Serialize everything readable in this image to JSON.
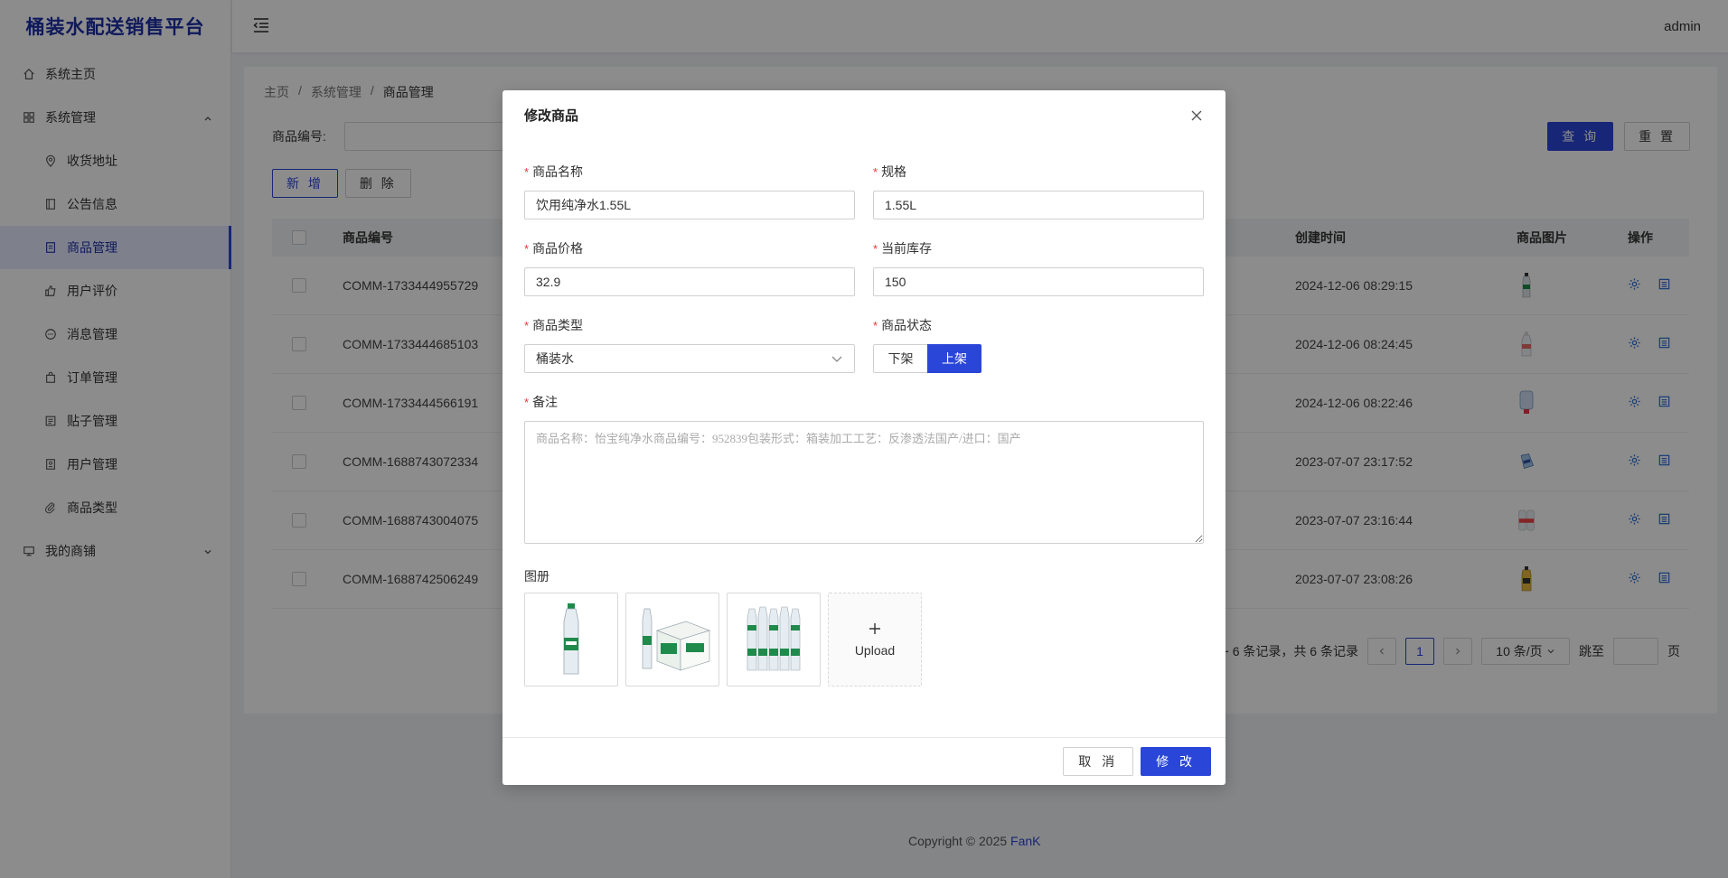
{
  "app": {
    "title": "桶装水配送销售平台",
    "user": "admin"
  },
  "sidebar": {
    "items": [
      {
        "label": "系统主页"
      },
      {
        "label": "系统管理"
      },
      {
        "label": "收货地址"
      },
      {
        "label": "公告信息"
      },
      {
        "label": "商品管理"
      },
      {
        "label": "用户评价"
      },
      {
        "label": "消息管理"
      },
      {
        "label": "订单管理"
      },
      {
        "label": "贴子管理"
      },
      {
        "label": "用户管理"
      },
      {
        "label": "商品类型"
      },
      {
        "label": "我的商铺"
      }
    ]
  },
  "breadcrumb": [
    "主页",
    "/",
    "系统管理",
    "/",
    "商品管理"
  ],
  "search": {
    "label": "商品编号:",
    "query_label": "查 询",
    "reset_label": "重 置"
  },
  "toolbar": {
    "add_label": "新 增",
    "delete_label": "删 除"
  },
  "table": {
    "columns": [
      "商品编号",
      "创建时间",
      "商品图片",
      "操作"
    ],
    "rows": [
      {
        "code": "COMM-1733444955729",
        "time": "2024-12-06 08:29:15"
      },
      {
        "code": "COMM-1733444685103",
        "time": "2024-12-06 08:24:45"
      },
      {
        "code": "COMM-1733444566191",
        "time": "2024-12-06 08:22:46"
      },
      {
        "code": "COMM-1688743072334",
        "time": "2023-07-07 23:17:52"
      },
      {
        "code": "COMM-1688743004075",
        "time": "2023-07-07 23:16:44"
      },
      {
        "code": "COMM-1688742506249",
        "time": "2023-07-07 23:08:26"
      }
    ]
  },
  "pagination": {
    "summary": "1 ~ 6 条记录，共 6 条记录",
    "current_page": "1",
    "page_size": "10 条/页",
    "jump_label": "跳至",
    "page_suffix": "页"
  },
  "footer": {
    "copyright": "Copyright © 2025",
    "author": "FanK"
  },
  "modal": {
    "title": "修改商品",
    "fields": {
      "name": {
        "label": "商品名称",
        "value": "饮用纯净水1.55L"
      },
      "spec": {
        "label": "规格",
        "value": "1.55L"
      },
      "price": {
        "label": "商品价格",
        "value": "32.9"
      },
      "stock": {
        "label": "当前库存",
        "value": "150"
      },
      "type": {
        "label": "商品类型",
        "value": "桶装水"
      },
      "status": {
        "label": "商品状态",
        "off_label": "下架",
        "on_label": "上架",
        "selected": "上架"
      },
      "remark": {
        "label": "备注",
        "placeholder": "商品名称：怡宝纯净水商品编号：952839包装形式：箱装加工工艺：反渗透法国产/进口：国产"
      }
    },
    "gallery_label": "图册",
    "upload_label": "Upload",
    "cancel_label": "取 消",
    "submit_label": "修 改"
  },
  "colors": {
    "primary": "#2a46d8",
    "required": "#e53935",
    "bottle_green": "#1f8a4c"
  }
}
